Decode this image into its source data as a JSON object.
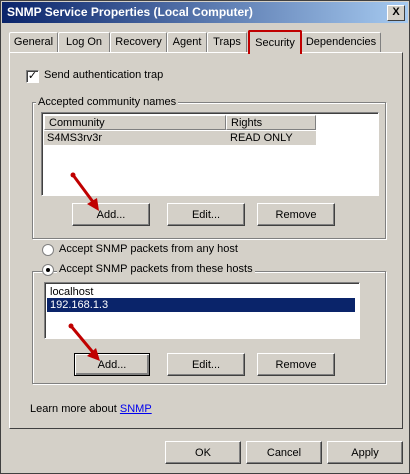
{
  "window": {
    "title": "SNMP Service Properties (Local Computer)",
    "close_label": "X"
  },
  "tabs": [
    "General",
    "Log On",
    "Recovery",
    "Agent",
    "Traps",
    "Security",
    "Dependencies"
  ],
  "active_tab": "Security",
  "send_auth_trap": {
    "label": "Send authentication trap",
    "checked": true,
    "check_glyph": "✓"
  },
  "community_group": {
    "title": "Accepted community names",
    "columns": [
      "Community",
      "Rights"
    ],
    "rows": [
      {
        "community": "S4MS3rv3r",
        "rights": "READ ONLY"
      }
    ],
    "buttons": {
      "add": "Add...",
      "edit": "Edit...",
      "remove": "Remove"
    }
  },
  "hosts": {
    "any_host_label": "Accept SNMP packets from any host",
    "these_hosts_label": "Accept SNMP packets from these hosts",
    "selected": "these_hosts",
    "list": [
      "localhost",
      "192.168.1.3"
    ],
    "selected_index": 1,
    "buttons": {
      "add": "Add...",
      "edit": "Edit...",
      "remove": "Remove"
    }
  },
  "learn_more": {
    "prefix": "Learn more about",
    "link": "SNMP"
  },
  "dialog_buttons": {
    "ok": "OK",
    "cancel": "Cancel",
    "apply": "Apply"
  },
  "colors": {
    "annotation_arrow": "#c00000",
    "selection": "#0a246a",
    "tab_highlight": "#c00000"
  },
  "icons": {
    "annotation_arrow": "red-arrow-icon"
  }
}
